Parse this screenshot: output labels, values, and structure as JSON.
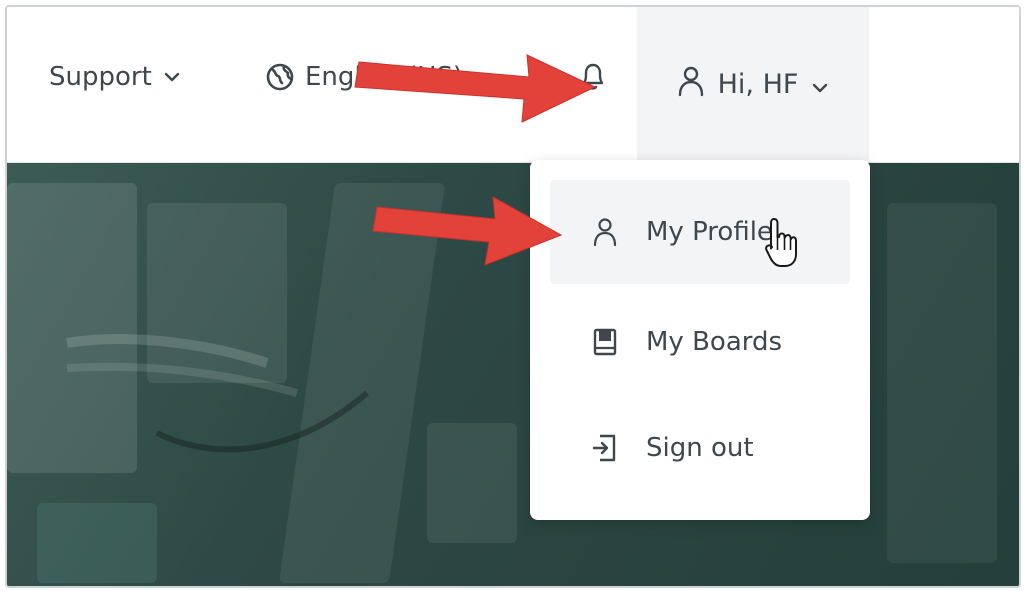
{
  "header": {
    "support_label": "Support",
    "language_label": "English (US)",
    "account_label": "Hi, HF"
  },
  "account_menu": {
    "items": [
      {
        "label": "My Profile",
        "icon": "person-icon"
      },
      {
        "label": "My Boards",
        "icon": "board-icon"
      },
      {
        "label": "Sign out",
        "icon": "sign-out-icon"
      }
    ]
  },
  "colors": {
    "annotation_arrow": "#e3423a",
    "text": "#3f474d",
    "hero_overlay": "#2e4a46"
  }
}
